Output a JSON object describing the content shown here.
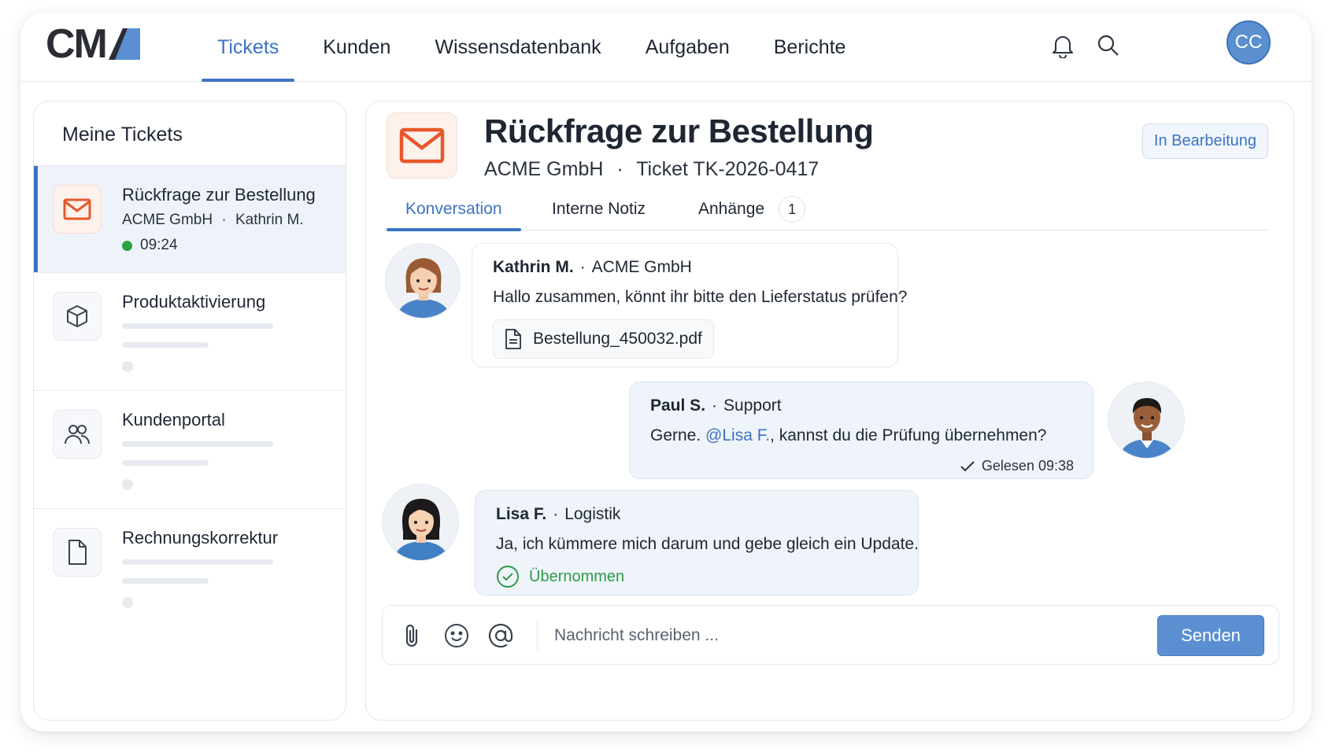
{
  "app": {
    "logo_text": "CM"
  },
  "nav": {
    "items": [
      "Tickets",
      "Kunden",
      "Wissensdatenbank",
      "Aufgaben",
      "Berichte"
    ],
    "active": "Tickets"
  },
  "user": {
    "initials": "CC"
  },
  "sidebar": {
    "title": "Meine Tickets",
    "tickets": [
      {
        "title": "Rückfrage zur Bestellung",
        "customer": "ACME GmbH",
        "sep": "·",
        "contact": "Kathrin M.",
        "time": "09:24",
        "icon": "mail-icon",
        "active": true
      },
      {
        "title": "Produktaktivierung",
        "icon": "box-icon"
      },
      {
        "title": "Kundenportal",
        "icon": "users-icon"
      },
      {
        "title": "Rechnungskorrektur",
        "icon": "document-icon"
      }
    ]
  },
  "ticket": {
    "title": "Rückfrage zur Bestellung",
    "customer": "ACME GmbH",
    "sep": "·",
    "number": "Ticket TK-2026-0417",
    "status": "In Bearbeitung"
  },
  "tabs": {
    "conversation": "Konversation",
    "internal_note": "Interne Notiz",
    "attachments": "Anhänge",
    "attachments_count": "1"
  },
  "messages": [
    {
      "author": "Kathrin M.",
      "sep": "·",
      "org": "ACME GmbH",
      "text": "Hallo zusammen, könnt ihr bitte den Lieferstatus prüfen?",
      "attachment": "Bestellung_450032.pdf"
    },
    {
      "author": "Paul S.",
      "sep": "·",
      "org": "Support",
      "text_before": "Gerne. ",
      "mention": "@Lisa F.",
      "text_after": ", kannst du die Prüfung übernehmen?",
      "read_status": "Gelesen 09:38"
    },
    {
      "author": "Lisa F.",
      "sep": "·",
      "org": "Logistik",
      "text": "Ja, ich kümmere mich darum und gebe gleich ein Update.",
      "status": "Übernommen"
    }
  ],
  "composer": {
    "placeholder": "Nachricht schreiben ...",
    "send_label": "Senden"
  },
  "colors": {
    "accent": "#3b73c4",
    "mail_orange": "#e8572a",
    "success": "#2e9a47"
  }
}
